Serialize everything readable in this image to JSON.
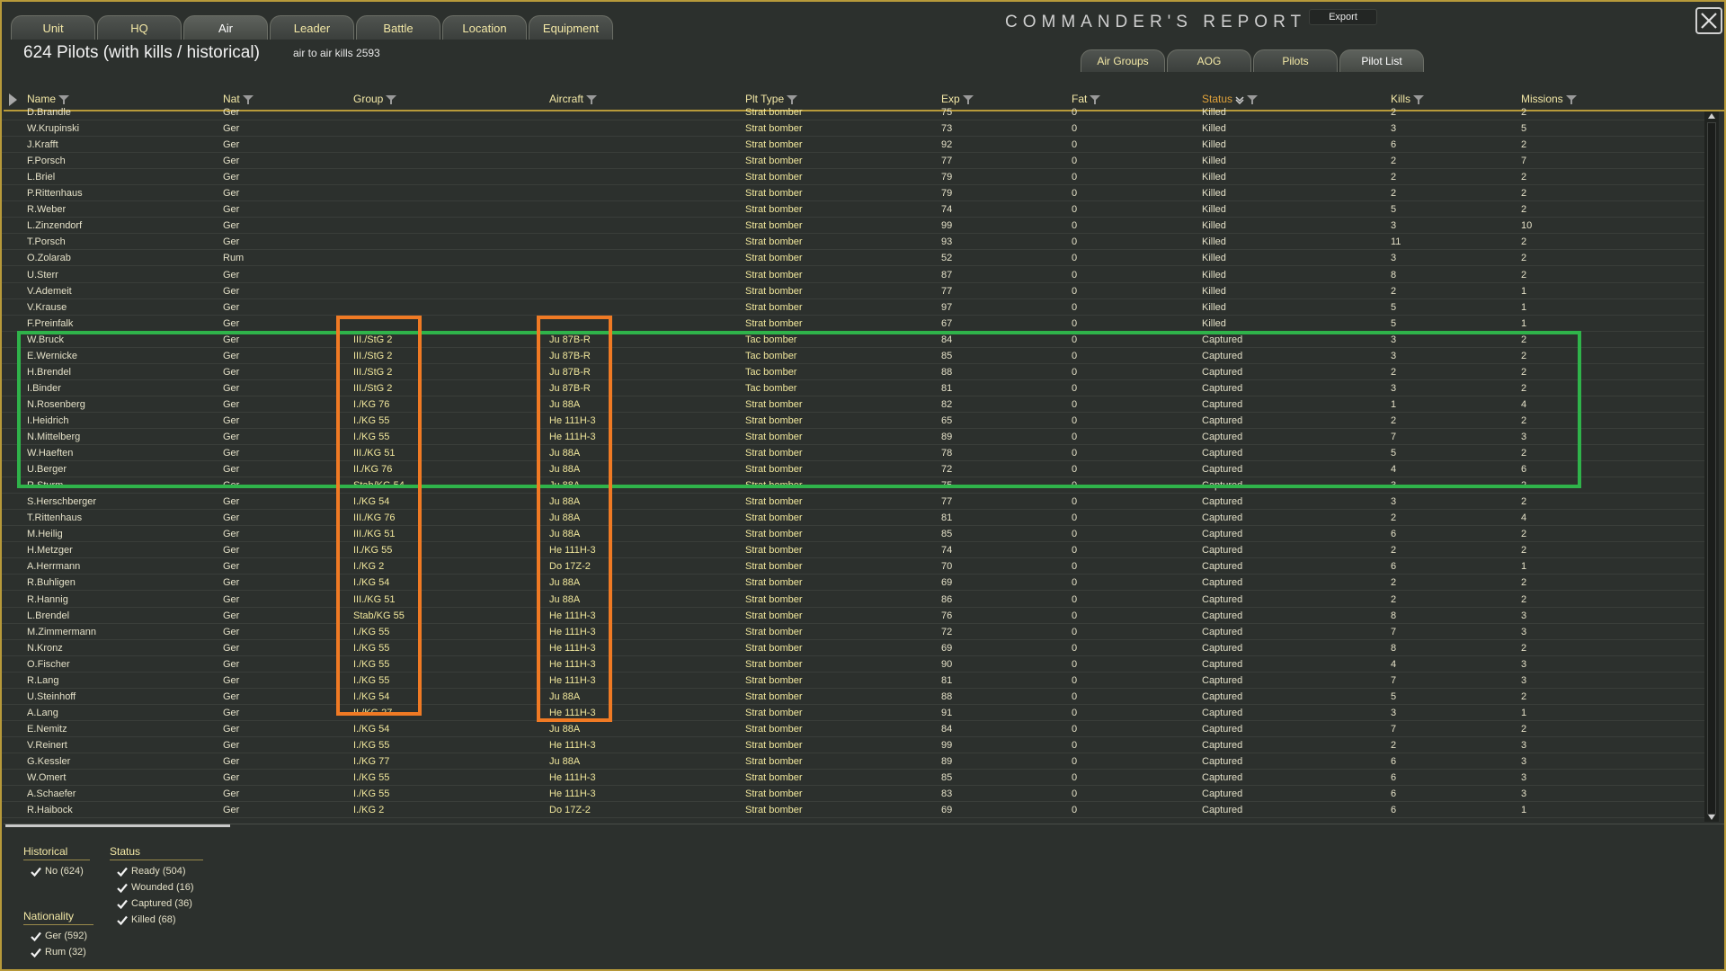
{
  "top_tabs": [
    "Unit",
    "HQ",
    "Air",
    "Leader",
    "Battle",
    "Location",
    "Equipment"
  ],
  "active_top_tab": "Air",
  "app_title": "COMMANDER'S  REPORT",
  "export_label": "Export",
  "page_title": "624 Pilots (with kills / historical)",
  "subtitle": "air to air kills 2593",
  "sub_tabs": [
    "Air Groups",
    "AOG",
    "Pilots",
    "Pilot List"
  ],
  "active_sub_tab": "Pilot List",
  "columns": {
    "name": "Name",
    "nat": "Nat",
    "group": "Group",
    "aircraft": "Aircraft",
    "plt_type": "Plt Type",
    "exp": "Exp",
    "fat": "Fat",
    "status": "Status",
    "kills": "Kills",
    "missions": "Missions"
  },
  "rows": [
    [
      "D.Brandle",
      "Ger",
      "",
      "",
      "Strat bomber",
      "75",
      "0",
      "Killed",
      "2",
      "2"
    ],
    [
      "W.Krupinski",
      "Ger",
      "",
      "",
      "Strat bomber",
      "73",
      "0",
      "Killed",
      "3",
      "5"
    ],
    [
      "J.Krafft",
      "Ger",
      "",
      "",
      "Strat bomber",
      "92",
      "0",
      "Killed",
      "6",
      "2"
    ],
    [
      "F.Porsch",
      "Ger",
      "",
      "",
      "Strat bomber",
      "77",
      "0",
      "Killed",
      "2",
      "7"
    ],
    [
      "L.Briel",
      "Ger",
      "",
      "",
      "Strat bomber",
      "79",
      "0",
      "Killed",
      "2",
      "2"
    ],
    [
      "P.Rittenhaus",
      "Ger",
      "",
      "",
      "Strat bomber",
      "79",
      "0",
      "Killed",
      "2",
      "2"
    ],
    [
      "R.Weber",
      "Ger",
      "",
      "",
      "Strat bomber",
      "74",
      "0",
      "Killed",
      "5",
      "2"
    ],
    [
      "L.Zinzendorf",
      "Ger",
      "",
      "",
      "Strat bomber",
      "99",
      "0",
      "Killed",
      "3",
      "10"
    ],
    [
      "T.Porsch",
      "Ger",
      "",
      "",
      "Strat bomber",
      "93",
      "0",
      "Killed",
      "11",
      "2"
    ],
    [
      "O.Zolarab",
      "Rum",
      "",
      "",
      "Strat bomber",
      "52",
      "0",
      "Killed",
      "3",
      "2"
    ],
    [
      "U.Sterr",
      "Ger",
      "",
      "",
      "Strat bomber",
      "87",
      "0",
      "Killed",
      "8",
      "2"
    ],
    [
      "V.Ademeit",
      "Ger",
      "",
      "",
      "Strat bomber",
      "77",
      "0",
      "Killed",
      "2",
      "1"
    ],
    [
      "V.Krause",
      "Ger",
      "",
      "",
      "Strat bomber",
      "97",
      "0",
      "Killed",
      "5",
      "1"
    ],
    [
      "F.Preinfalk",
      "Ger",
      "",
      "",
      "Strat bomber",
      "67",
      "0",
      "Killed",
      "5",
      "1"
    ],
    [
      "W.Bruck",
      "Ger",
      "III./StG 2",
      "Ju 87B-R",
      "Tac bomber",
      "84",
      "0",
      "Captured",
      "3",
      "2"
    ],
    [
      "E.Wernicke",
      "Ger",
      "III./StG 2",
      "Ju 87B-R",
      "Tac bomber",
      "85",
      "0",
      "Captured",
      "3",
      "2"
    ],
    [
      "H.Brendel",
      "Ger",
      "III./StG 2",
      "Ju 87B-R",
      "Tac bomber",
      "88",
      "0",
      "Captured",
      "2",
      "2"
    ],
    [
      "I.Binder",
      "Ger",
      "III./StG 2",
      "Ju 87B-R",
      "Tac bomber",
      "81",
      "0",
      "Captured",
      "3",
      "2"
    ],
    [
      "N.Rosenberg",
      "Ger",
      "I./KG 76",
      "Ju 88A",
      "Strat bomber",
      "82",
      "0",
      "Captured",
      "1",
      "4"
    ],
    [
      "I.Heidrich",
      "Ger",
      "I./KG 55",
      "He 111H-3",
      "Strat bomber",
      "65",
      "0",
      "Captured",
      "2",
      "2"
    ],
    [
      "N.Mittelberg",
      "Ger",
      "I./KG 55",
      "He 111H-3",
      "Strat bomber",
      "89",
      "0",
      "Captured",
      "7",
      "3"
    ],
    [
      "W.Haeften",
      "Ger",
      "III./KG 51",
      "Ju 88A",
      "Strat bomber",
      "78",
      "0",
      "Captured",
      "5",
      "2"
    ],
    [
      "U.Berger",
      "Ger",
      "II./KG 76",
      "Ju 88A",
      "Strat bomber",
      "72",
      "0",
      "Captured",
      "4",
      "6"
    ],
    [
      "R.Sturm",
      "Ger",
      "Stab/KG 54",
      "Ju 88A",
      "Strat bomber",
      "75",
      "0",
      "Captured",
      "3",
      "2"
    ],
    [
      "S.Herschberger",
      "Ger",
      "I./KG 54",
      "Ju 88A",
      "Strat bomber",
      "77",
      "0",
      "Captured",
      "3",
      "2"
    ],
    [
      "T.Rittenhaus",
      "Ger",
      "III./KG 76",
      "Ju 88A",
      "Strat bomber",
      "81",
      "0",
      "Captured",
      "2",
      "4"
    ],
    [
      "M.Heilig",
      "Ger",
      "III./KG 51",
      "Ju 88A",
      "Strat bomber",
      "85",
      "0",
      "Captured",
      "6",
      "2"
    ],
    [
      "H.Metzger",
      "Ger",
      "II./KG 55",
      "He 111H-3",
      "Strat bomber",
      "74",
      "0",
      "Captured",
      "2",
      "2"
    ],
    [
      "A.Herrmann",
      "Ger",
      "I./KG 2",
      "Do 17Z-2",
      "Strat bomber",
      "70",
      "0",
      "Captured",
      "6",
      "1"
    ],
    [
      "R.Buhligen",
      "Ger",
      "I./KG 54",
      "Ju 88A",
      "Strat bomber",
      "69",
      "0",
      "Captured",
      "2",
      "2"
    ],
    [
      "R.Hannig",
      "Ger",
      "III./KG 51",
      "Ju 88A",
      "Strat bomber",
      "86",
      "0",
      "Captured",
      "2",
      "2"
    ],
    [
      "L.Brendel",
      "Ger",
      "Stab/KG 55",
      "He 111H-3",
      "Strat bomber",
      "76",
      "0",
      "Captured",
      "8",
      "3"
    ],
    [
      "M.Zimmermann",
      "Ger",
      "I./KG 55",
      "He 111H-3",
      "Strat bomber",
      "72",
      "0",
      "Captured",
      "7",
      "3"
    ],
    [
      "N.Kronz",
      "Ger",
      "I./KG 55",
      "He 111H-3",
      "Strat bomber",
      "69",
      "0",
      "Captured",
      "8",
      "2"
    ],
    [
      "O.Fischer",
      "Ger",
      "I./KG 55",
      "He 111H-3",
      "Strat bomber",
      "90",
      "0",
      "Captured",
      "4",
      "3"
    ],
    [
      "R.Lang",
      "Ger",
      "I./KG 55",
      "He 111H-3",
      "Strat bomber",
      "81",
      "0",
      "Captured",
      "7",
      "3"
    ],
    [
      "U.Steinhoff",
      "Ger",
      "I./KG 54",
      "Ju 88A",
      "Strat bomber",
      "88",
      "0",
      "Captured",
      "5",
      "2"
    ],
    [
      "A.Lang",
      "Ger",
      "II./KG 27",
      "He 111H-3",
      "Strat bomber",
      "91",
      "0",
      "Captured",
      "3",
      "1"
    ],
    [
      "E.Nemitz",
      "Ger",
      "I./KG 54",
      "Ju 88A",
      "Strat bomber",
      "84",
      "0",
      "Captured",
      "7",
      "2"
    ],
    [
      "V.Reinert",
      "Ger",
      "I./KG 55",
      "He 111H-3",
      "Strat bomber",
      "99",
      "0",
      "Captured",
      "2",
      "3"
    ],
    [
      "G.Kessler",
      "Ger",
      "I./KG 77",
      "Ju 88A",
      "Strat bomber",
      "89",
      "0",
      "Captured",
      "6",
      "3"
    ],
    [
      "W.Omert",
      "Ger",
      "I./KG 55",
      "He 111H-3",
      "Strat bomber",
      "85",
      "0",
      "Captured",
      "6",
      "3"
    ],
    [
      "A.Schaefer",
      "Ger",
      "I./KG 55",
      "He 111H-3",
      "Strat bomber",
      "83",
      "0",
      "Captured",
      "6",
      "3"
    ],
    [
      "R.Haibock",
      "Ger",
      "I./KG 2",
      "Do 17Z-2",
      "Strat bomber",
      "69",
      "0",
      "Captured",
      "6",
      "1"
    ]
  ],
  "filters": {
    "historical": {
      "title": "Historical",
      "items": [
        "No (624)"
      ]
    },
    "status": {
      "title": "Status",
      "items": [
        "Ready (504)",
        "Wounded (16)",
        "Captured (36)",
        "Killed (68)"
      ]
    },
    "nationality": {
      "title": "Nationality",
      "items": [
        "Ger (592)",
        "Rum (32)"
      ]
    }
  },
  "colors": {
    "accent": "#b79a3a",
    "highlight_green": "#2fb34a",
    "highlight_orange": "#f07a24"
  }
}
